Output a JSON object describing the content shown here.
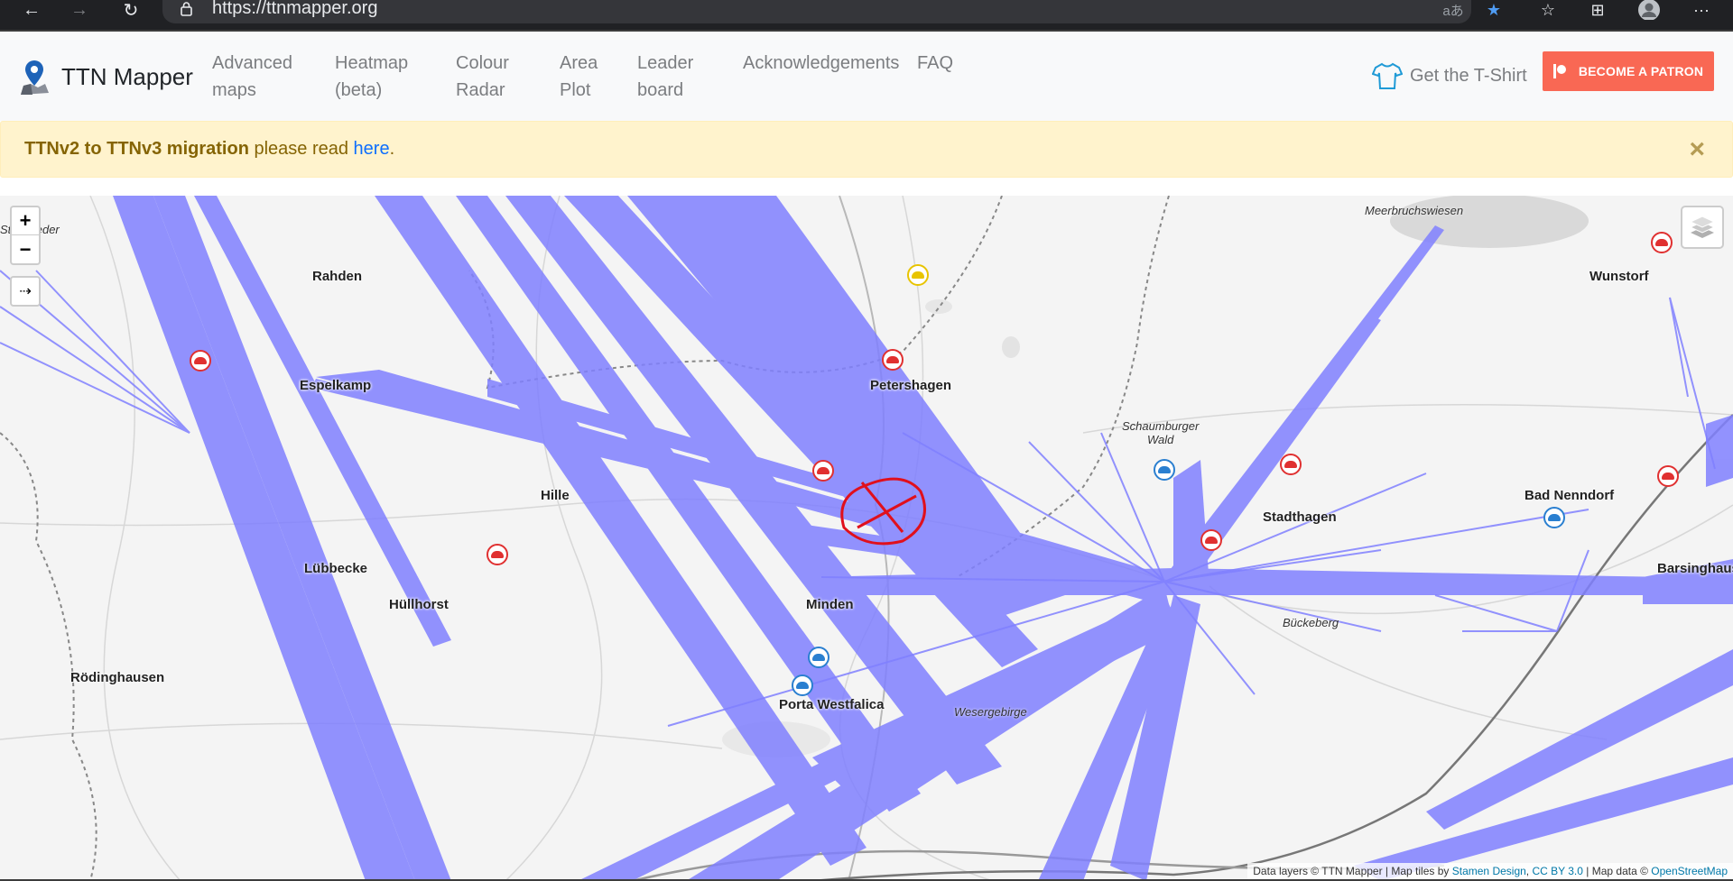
{
  "browser": {
    "url": "https://ttnmapper.org"
  },
  "navbar": {
    "brand": "TTN Mapper",
    "items": [
      {
        "label": "Advanced\nmaps"
      },
      {
        "label": "Heatmap\n(beta)"
      },
      {
        "label": "Colour\nRadar"
      },
      {
        "label": "Area\nPlot"
      },
      {
        "label": "Leader\nboard"
      },
      {
        "label": "Acknowledgements"
      },
      {
        "label": "FAQ"
      }
    ],
    "tshirt": "Get the T-Shirt",
    "patron": "BECOME A PATRON"
  },
  "alert": {
    "bold": "TTNv2 to TTNv3 migration",
    "text": " please read ",
    "link": "here",
    "end": ".",
    "close": "×"
  },
  "map": {
    "zoom_in": "+",
    "zoom_out": "−",
    "locate": "⇢",
    "towns": [
      {
        "name": "Rahden"
      },
      {
        "name": "Espelkamp"
      },
      {
        "name": "Petershagen"
      },
      {
        "name": "Hille"
      },
      {
        "name": "Lübbecke"
      },
      {
        "name": "Hüllhorst"
      },
      {
        "name": "Minden"
      },
      {
        "name": "Rödinghausen"
      },
      {
        "name": "Porta Westfalica"
      },
      {
        "name": "Stadthagen"
      },
      {
        "name": "Bad Nenndorf"
      },
      {
        "name": "Wunstorf"
      },
      {
        "name": "Barsinghausen"
      }
    ],
    "places": [
      {
        "name": "Meerbruchswiesen"
      },
      {
        "name": "Schaumburger\nWald"
      },
      {
        "name": "Bückeberg"
      },
      {
        "name": "Wesergebirge"
      },
      {
        "name": "Stemweder"
      }
    ],
    "attribution": {
      "pre": "Data layers © TTN Mapper | Map tiles by ",
      "stamen": "Stamen Design",
      "sep": ", ",
      "cc": "CC BY 3.0",
      "mid": " | Map data © ",
      "osm": "OpenStreetMap"
    },
    "colors": {
      "line": "#8080ff",
      "gateway_red": "#e03030",
      "gateway_blue": "#2a7fd0",
      "gateway_green": "#2cb42c",
      "gateway_yellow": "#e8c400",
      "annotation": "#e0101c"
    }
  }
}
